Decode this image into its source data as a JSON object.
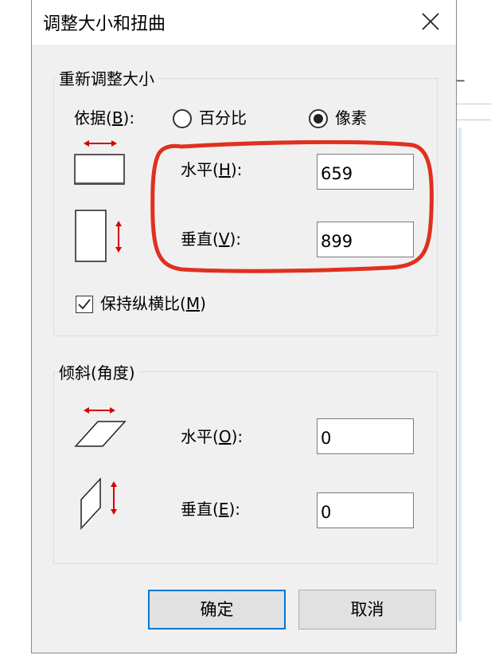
{
  "window": {
    "title": "调整大小和扭曲"
  },
  "resize": {
    "group_title": "重新调整大小",
    "basis_label_pre": "依据(",
    "basis_label_key": "B",
    "basis_label_post": "):",
    "options": [
      {
        "label": "百分比",
        "checked": false
      },
      {
        "label": "像素",
        "checked": true
      }
    ],
    "horizontal": {
      "label_pre": "水平(",
      "label_key": "H",
      "label_post": "):",
      "value": "659"
    },
    "vertical": {
      "label_pre": "垂直(",
      "label_key": "V",
      "label_post": "):",
      "value": "899"
    },
    "keep_ratio": {
      "label_pre": "保持纵横比(",
      "label_key": "M",
      "label_post": ")",
      "checked": true
    }
  },
  "skew": {
    "group_title": "倾斜(角度)",
    "horizontal": {
      "label_pre": "水平(",
      "label_key": "O",
      "label_post": "):",
      "value": "0"
    },
    "vertical": {
      "label_pre": "垂直(",
      "label_key": "E",
      "label_post": "):",
      "value": "0"
    }
  },
  "buttons": {
    "ok": "确定",
    "cancel": "取消"
  },
  "colors": {
    "arrow_red": "#d40000",
    "annotation_red": "#e0301e",
    "default_button_border": "#0078d7"
  }
}
